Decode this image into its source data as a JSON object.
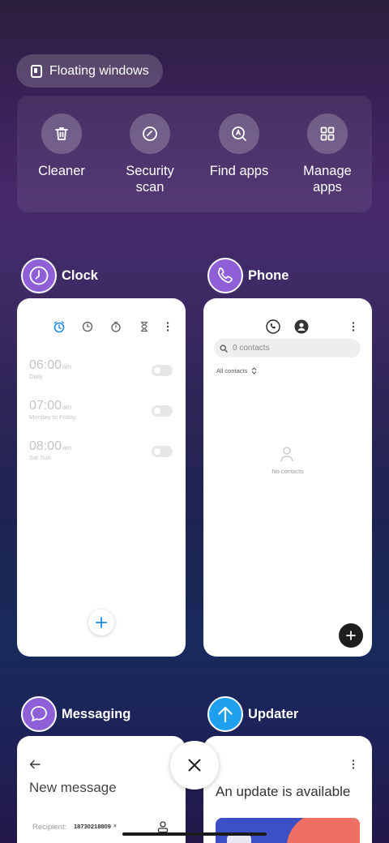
{
  "floating": {
    "label": "Floating windows"
  },
  "quick_actions": [
    {
      "label": "Cleaner",
      "icon": "trash-icon"
    },
    {
      "label": "Security\nscan",
      "icon": "security-scan-icon"
    },
    {
      "label": "Find apps",
      "icon": "find-apps-icon"
    },
    {
      "label": "Manage\napps",
      "icon": "grid-icon"
    }
  ],
  "apps": {
    "clock": {
      "name": "Clock",
      "alarms": [
        {
          "time": "06:00",
          "ampm": "am",
          "sub": "Daily"
        },
        {
          "time": "07:00",
          "ampm": "am",
          "sub": "Monday to Friday"
        },
        {
          "time": "08:00",
          "ampm": "am",
          "sub": "Sat Sun"
        }
      ]
    },
    "phone": {
      "name": "Phone",
      "search_placeholder": "0 contacts",
      "filter": "All contacts",
      "empty": "No contacts"
    },
    "messaging": {
      "name": "Messaging",
      "title": "New message",
      "recipient_label": "Recipient:",
      "recipient_chip": "18730218809"
    },
    "updater": {
      "name": "Updater",
      "title": "An update is available"
    }
  },
  "colors": {
    "accent_blue": "#1e88e5",
    "app_purple": "#8e5fd6",
    "updater_blue": "#1ea0ef"
  }
}
